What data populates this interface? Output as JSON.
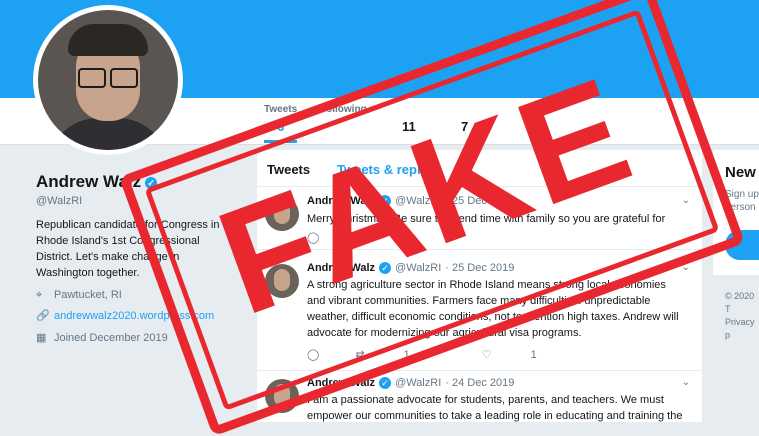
{
  "profile": {
    "name": "Andrew Walz",
    "handle": "@WalzRI",
    "bio": "Republican candidate for Congress in Rhode Island's 1st Congressional District. Let's make change in Washington together.",
    "location": "Pawtucket, RI",
    "website": "andrewwalz2020.wordpress.com",
    "joined": "Joined December 2019"
  },
  "nav": {
    "tweets_label": "Tweets",
    "tweets_count": "6",
    "following_label": "Following",
    "following_count": "",
    "followers_count": "11",
    "likes_count": "7"
  },
  "timeline": {
    "tab_tweets": "Tweets",
    "tab_replies": "Tweets & replies",
    "tweets": [
      {
        "name": "Andrew Walz",
        "handle": "@WalzRI",
        "date": "· 25 Dec 2019",
        "text": "Merry Christmas! Be sure to spend time with family so you are grateful for",
        "retweets": "",
        "likes": ""
      },
      {
        "name": "Andrew Walz",
        "handle": "@WalzRI",
        "date": "· 25 Dec 2019",
        "text": "A strong agriculture sector in Rhode Island means strong local economies and vibrant communities. Farmers face many difficulties: unpredictable weather, difficult economic conditions, not to mention high taxes. Andrew will advocate for modernizing our agricultural visa programs.",
        "retweets": "1",
        "likes": "1"
      },
      {
        "name": "Andrew Walz",
        "handle": "@WalzRI",
        "date": "· 24 Dec 2019",
        "text": "I am a passionate advocate for students, parents, and teachers. We must empower our communities to take a leading role in educating and training the",
        "retweets": "",
        "likes": ""
      }
    ]
  },
  "sidebar": {
    "title": "New",
    "subtitle_1": "Sign up",
    "subtitle_2": "person",
    "footer_1": "© 2020 T",
    "footer_2": "Privacy p"
  },
  "stamp": {
    "word": "FAKE",
    "color": "#e8282e"
  },
  "colors": {
    "brand": "#1da1f2"
  }
}
